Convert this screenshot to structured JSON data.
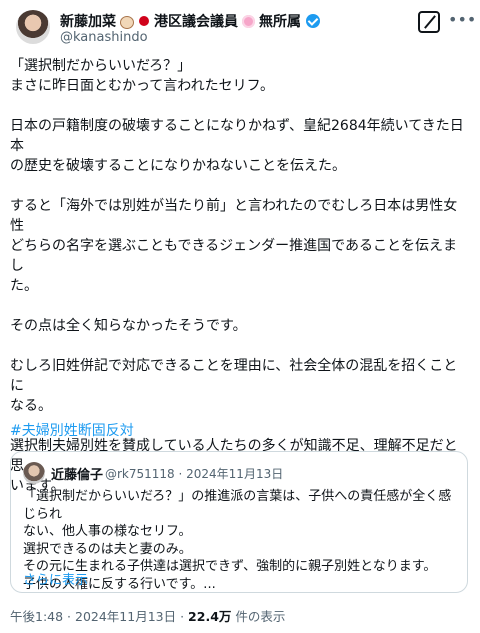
{
  "author": {
    "name": "新藤加菜",
    "title": "港区議会議員",
    "affiliation": "無所属",
    "handle": "@kanashindo"
  },
  "post": {
    "paragraphs": [
      [
        "「選択制だからいいだろ？」",
        "まさに昨日面とむかって言われたセリフ。"
      ],
      [
        "日本の戸籍制度の破壊することになりかねず、皇紀2684年続いてきた日本",
        "の歴史を破壊することになりかねないことを伝えた。"
      ],
      [
        "すると「海外では別姓が当たり前」と言われたのでむしろ日本は男性女性",
        "どちらの名字を選ぶこともできるジェンダー推進国であることを伝えまし",
        "た。"
      ],
      [
        "その点は全く知らなかったそうです。"
      ],
      [
        "むしろ旧姓併記で対応できることを理由に、社会全体の混乱を招くことに",
        "なる。"
      ],
      [
        "選択制夫婦別姓を賛成している人たちの多くが知識不足、理解不足だと思",
        "います。"
      ]
    ],
    "hashtag": "#夫婦別姓断固反対"
  },
  "quote": {
    "name": "近藤倫子",
    "handle_date": "@rk751118 · 2024年11月13日",
    "lines": [
      "「選択制だからいいだろ？」の推進派の言葉は、子供への責任感が全く感じられ",
      "ない、他人事の様なセリフ。",
      "選択できるのは夫と妻のみ。",
      "その元に生まれる子供達は選択できず、強制的に親子別姓となります。",
      "子供の人権に反する行いです。..."
    ],
    "show_more": "さらに表示"
  },
  "meta": {
    "time_date": "午後1:48 · 2024年11月13日 · ",
    "views": "22.4万",
    "views_label": " 件の表示"
  },
  "colors": {
    "accent": "#1d9bf0",
    "text": "#0f1419",
    "secondary": "#536471",
    "border": "#cfd9de"
  },
  "icons": [
    "dog-emoji-icon",
    "japan-flag-icon",
    "flower-emoji-icon",
    "verified-badge-icon",
    "grok-icon",
    "more-options-icon"
  ]
}
